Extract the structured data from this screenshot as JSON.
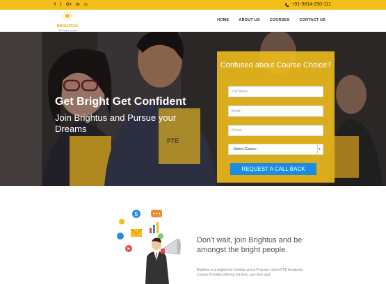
{
  "topbar": {
    "social": [
      {
        "icon": "facebook-icon",
        "glyph": "f"
      },
      {
        "icon": "twitter-icon",
        "glyph": "𝕥"
      },
      {
        "icon": "google-plus-icon",
        "glyph": "G+"
      },
      {
        "icon": "linkedin-icon",
        "glyph": "in"
      },
      {
        "icon": "instagram-icon",
        "glyph": "◎"
      }
    ],
    "phone": "+91-9814-250-111"
  },
  "logo": {
    "name": "BRIGHTUS",
    "tagline": "The bright people"
  },
  "nav": {
    "items": [
      "HOME",
      "ABOUT US",
      "COURSES",
      "CONTACT US"
    ]
  },
  "hero": {
    "title": "Get Bright Get Confident",
    "subtitle": "Join Brightus and Pursue your Dreams"
  },
  "form": {
    "title": "Confused about Course Choice?",
    "full_name_placeholder": "Full Name",
    "email_placeholder": "Email",
    "phone_placeholder": "Phone",
    "select_value": "--Select Course--",
    "submit": "REQUEST A CALL BACK"
  },
  "about": {
    "heading": "Don't wait, join Brightus and be amongst the bright people.",
    "text": "Brightus is a registered Institute and a Pearson Listed PTE Academic Course Provider offering full-time, part-time and"
  },
  "colors": {
    "accent": "#f4bf1b",
    "button": "#1a8de0"
  }
}
